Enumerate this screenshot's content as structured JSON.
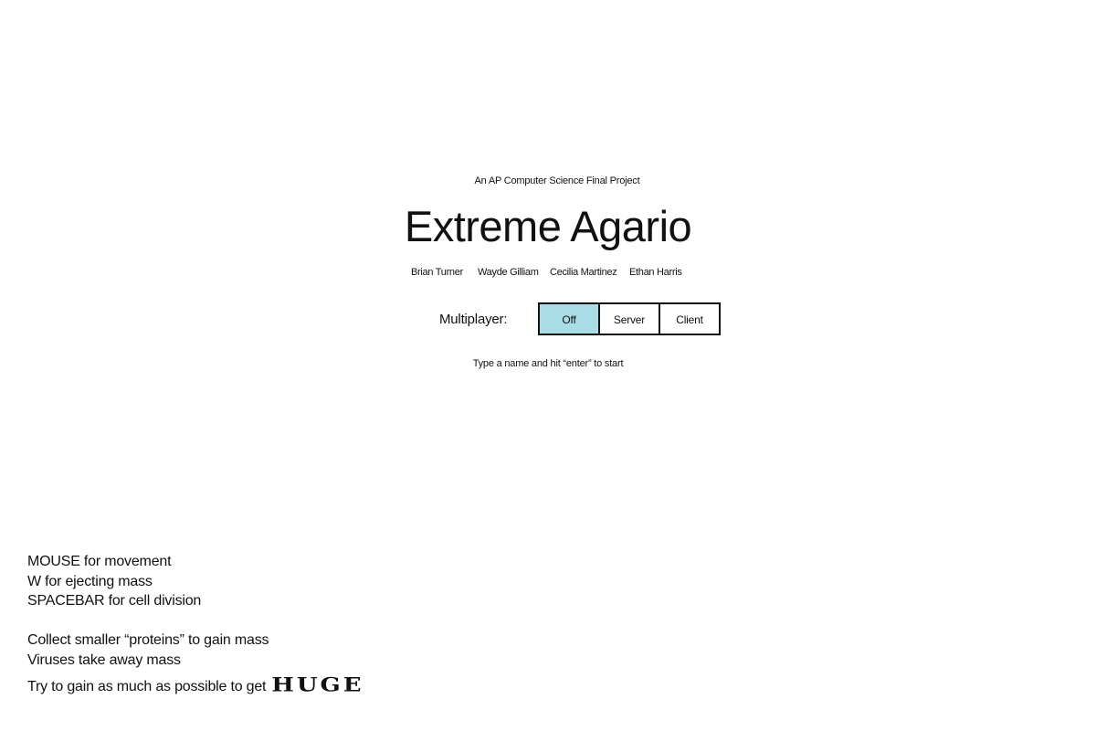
{
  "header": {
    "subtitle": "An AP Computer Science Final Project",
    "title": "Extreme Agario",
    "authors": [
      "Brian Turner",
      "Wayde Gilliam",
      "Cecilia Martinez",
      "Ethan Harris"
    ]
  },
  "multiplayer": {
    "label": "Multiplayer:",
    "options": [
      "Off",
      "Server",
      "Client"
    ],
    "selected": "Off",
    "selected_color": "#a8dde6"
  },
  "hint": "Type a name and hit “enter” to start",
  "controls": [
    "MOUSE for movement",
    "W for ejecting mass",
    "SPACEBAR for cell division"
  ],
  "info": {
    "line1": "Collect smaller “proteins” to gain mass",
    "line2": "Viruses take away mass",
    "line3": "Try to gain as much as possible to get",
    "huge": "HUGE"
  }
}
